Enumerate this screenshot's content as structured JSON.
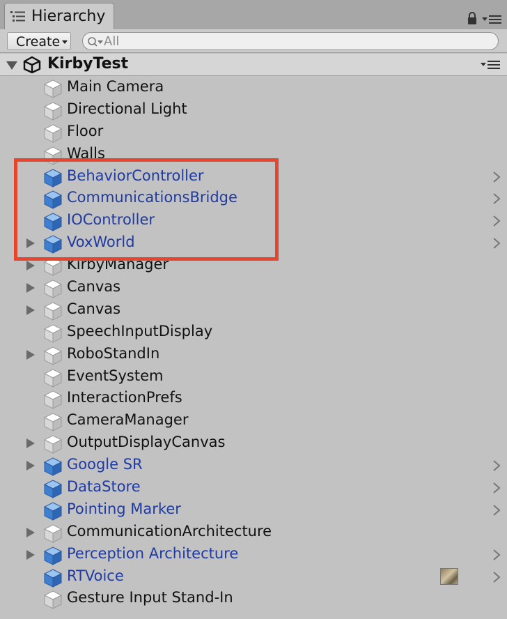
{
  "window": {
    "tab_title": "Hierarchy",
    "tab_icon": "hierarchy-list-icon",
    "lock_icon": "lock-icon",
    "tab_menu_icon": "panel-menu-icon"
  },
  "toolbar": {
    "create_label": "Create",
    "search_placeholder": "All",
    "search_value": ""
  },
  "scene": {
    "name": "KirbyTest",
    "icon": "unity-logo-icon",
    "expanded": true
  },
  "colors": {
    "prefab_text": "#1f3aa0",
    "normal_text": "#111111",
    "panel_bg": "#c2c2c2",
    "highlight_box": "#e8452f",
    "prefab_cube": "#4f8fd8",
    "object_cube": "#e9e9e9"
  },
  "objects": [
    {
      "name": "Main Camera",
      "prefab": false,
      "expandable": false,
      "has_chevron": false
    },
    {
      "name": "Directional Light",
      "prefab": false,
      "expandable": false,
      "has_chevron": false
    },
    {
      "name": "Floor",
      "prefab": false,
      "expandable": false,
      "has_chevron": false
    },
    {
      "name": "Walls",
      "prefab": false,
      "expandable": false,
      "has_chevron": false
    },
    {
      "name": "BehaviorController",
      "prefab": true,
      "expandable": false,
      "has_chevron": true
    },
    {
      "name": "CommunicationsBridge",
      "prefab": true,
      "expandable": false,
      "has_chevron": true
    },
    {
      "name": "IOController",
      "prefab": true,
      "expandable": false,
      "has_chevron": true
    },
    {
      "name": "VoxWorld",
      "prefab": true,
      "expandable": true,
      "has_chevron": true
    },
    {
      "name": "KirbyManager",
      "prefab": false,
      "expandable": true,
      "has_chevron": false
    },
    {
      "name": "Canvas",
      "prefab": false,
      "expandable": true,
      "has_chevron": false
    },
    {
      "name": "Canvas",
      "prefab": false,
      "expandable": true,
      "has_chevron": false
    },
    {
      "name": "SpeechInputDisplay",
      "prefab": false,
      "expandable": false,
      "has_chevron": false
    },
    {
      "name": "RoboStandIn",
      "prefab": false,
      "expandable": true,
      "has_chevron": false
    },
    {
      "name": "EventSystem",
      "prefab": false,
      "expandable": false,
      "has_chevron": false
    },
    {
      "name": "InteractionPrefs",
      "prefab": false,
      "expandable": false,
      "has_chevron": false
    },
    {
      "name": "CameraManager",
      "prefab": false,
      "expandable": false,
      "has_chevron": false
    },
    {
      "name": "OutputDisplayCanvas",
      "prefab": false,
      "expandable": true,
      "has_chevron": false
    },
    {
      "name": "Google SR",
      "prefab": true,
      "expandable": true,
      "has_chevron": true
    },
    {
      "name": "DataStore",
      "prefab": true,
      "expandable": false,
      "has_chevron": true
    },
    {
      "name": "Pointing Marker",
      "prefab": true,
      "expandable": false,
      "has_chevron": true
    },
    {
      "name": "CommunicationArchitecture",
      "prefab": false,
      "expandable": true,
      "has_chevron": false
    },
    {
      "name": "Perception Architecture",
      "prefab": true,
      "expandable": true,
      "has_chevron": true
    },
    {
      "name": "RTVoice",
      "prefab": true,
      "expandable": false,
      "has_chevron": true,
      "has_thumbnail": true
    },
    {
      "name": "Gesture Input Stand-In",
      "prefab": false,
      "expandable": false,
      "has_chevron": false
    }
  ]
}
